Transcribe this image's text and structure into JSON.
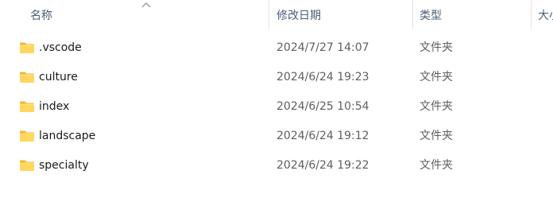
{
  "columns": {
    "name": "名称",
    "date": "修改日期",
    "type": "类型",
    "size": "大小"
  },
  "sort": {
    "column": "name",
    "direction": "ascending"
  },
  "icons": {
    "folder": "folder-icon",
    "sort": "sort-ascending-icon"
  },
  "colors": {
    "folder_body": "#ffd75e",
    "folder_tab": "#f0b82e",
    "header_text": "#4c607a"
  },
  "rows": [
    {
      "name": ".vscode",
      "date": "2024/7/27 14:07",
      "type": "文件夹"
    },
    {
      "name": "culture",
      "date": "2024/6/24 19:23",
      "type": "文件夹"
    },
    {
      "name": "index",
      "date": "2024/6/25 10:54",
      "type": "文件夹"
    },
    {
      "name": "landscape",
      "date": "2024/6/24 19:12",
      "type": "文件夹"
    },
    {
      "name": "specialty",
      "date": "2024/6/24 19:22",
      "type": "文件夹"
    }
  ]
}
